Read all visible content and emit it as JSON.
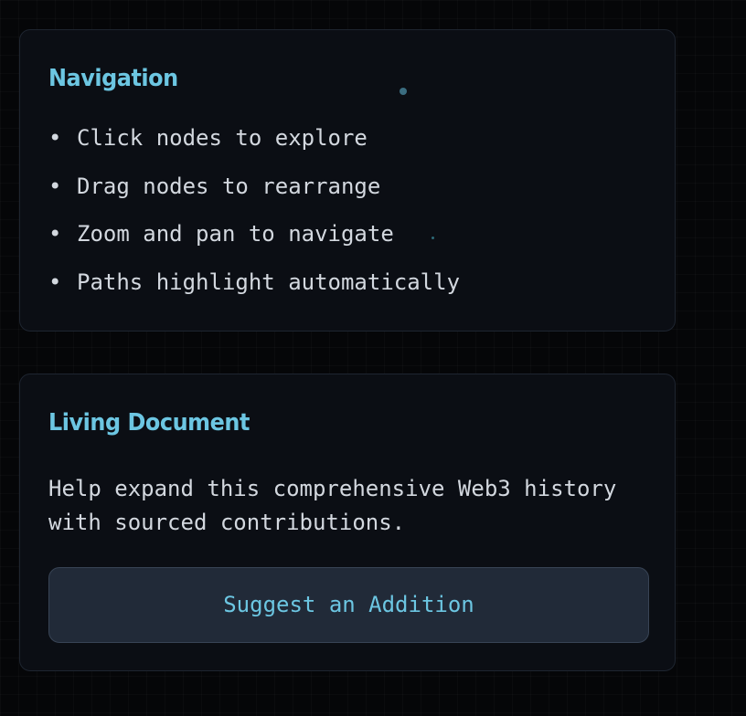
{
  "navigation": {
    "title": "Navigation",
    "bullet": "•",
    "items": [
      {
        "label": "Click nodes to explore"
      },
      {
        "label": "Drag nodes to rearrange"
      },
      {
        "label": "Zoom and pan to navigate"
      },
      {
        "label": "Paths highlight automatically"
      }
    ]
  },
  "living_document": {
    "title": "Living Document",
    "description": "Help expand this comprehensive Web3 history with sourced contributions.",
    "button_label": "Suggest an Addition"
  },
  "colors": {
    "background": "#050608",
    "panel": "#0b0e14",
    "accent": "#6cc6e2",
    "text": "#d3d8df",
    "button_bg": "#212a38"
  }
}
